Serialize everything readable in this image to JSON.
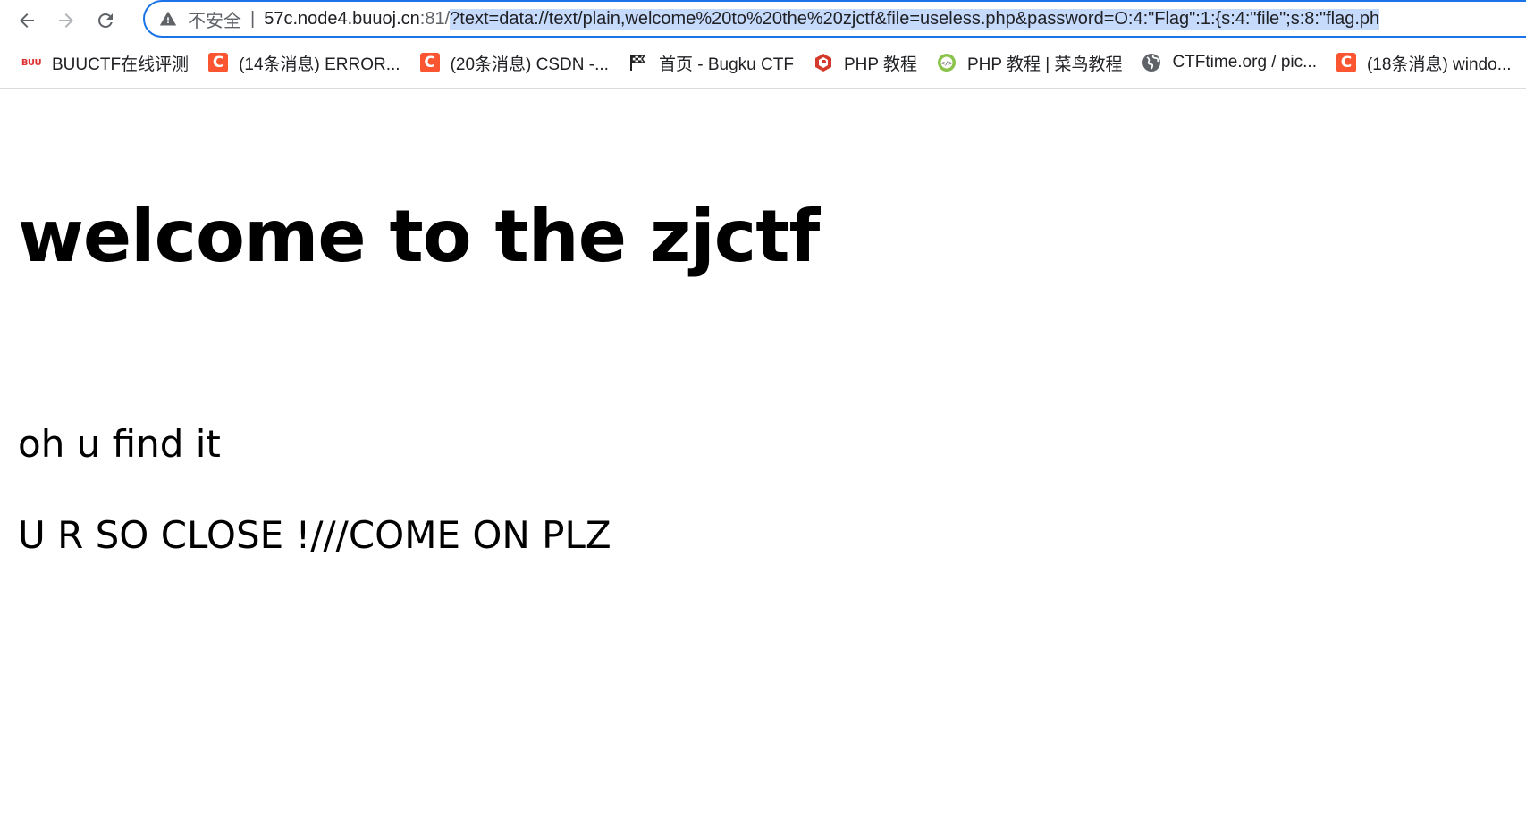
{
  "browser": {
    "security_label": "不安全",
    "url_host": "57c.node4.buuoj.cn",
    "url_port": ":81/",
    "url_query": "?text=data://text/plain,welcome%20to%20the%20zjctf&file=useless.php&password=O:4:\"Flag\":1:{s:4:\"file\";s:8:\"flag.ph",
    "accent_color": "#1a73e8"
  },
  "bookmarks": [
    {
      "label": "BUUCTF在线评测",
      "icon": "buuctf-icon"
    },
    {
      "label": "(14条消息) ERROR...",
      "icon": "csdn-icon"
    },
    {
      "label": "(20条消息) CSDN -...",
      "icon": "csdn-icon"
    },
    {
      "label": "首页 - Bugku CTF",
      "icon": "flag-icon"
    },
    {
      "label": "PHP 教程",
      "icon": "php-icon"
    },
    {
      "label": "PHP 教程 | 菜鸟教程",
      "icon": "runoob-icon"
    },
    {
      "label": "CTFtime.org / pic...",
      "icon": "globe-icon"
    },
    {
      "label": "(18条消息) windo...",
      "icon": "csdn-icon"
    }
  ],
  "page": {
    "heading": "welcome to the zjctf",
    "line1": "oh u find it",
    "line2": "U R SO CLOSE !///COME ON PLZ"
  }
}
